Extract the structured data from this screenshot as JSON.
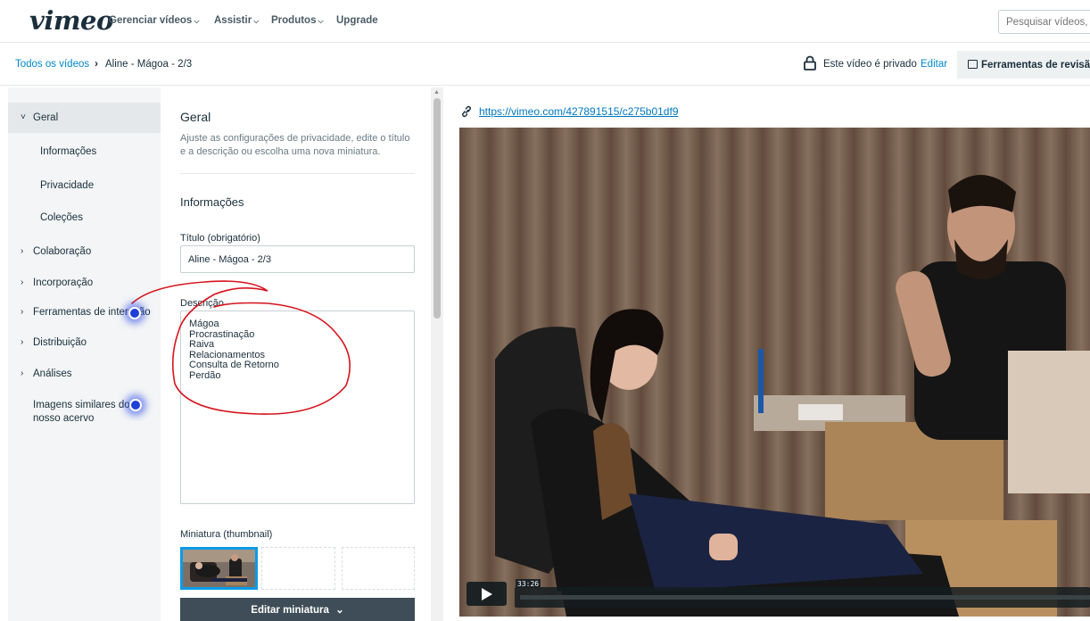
{
  "nav": {
    "logo": "vimeo",
    "items": [
      {
        "label": "Gerenciar vídeos",
        "has_menu": true
      },
      {
        "label": "Assistir",
        "has_menu": true
      },
      {
        "label": "Produtos",
        "has_menu": true
      },
      {
        "label": "Upgrade",
        "has_menu": false
      }
    ],
    "search_placeholder": "Pesquisar vídeos,"
  },
  "breadcrumb": {
    "root": "Todos os vídeos",
    "separator": "›",
    "current": "Aline - Mágoa - 2/3"
  },
  "privacy": {
    "icon": "lock-icon",
    "text": "Este vídeo é privado",
    "edit": "Editar"
  },
  "review_tools": {
    "icon": "review-icon",
    "label": "Ferramentas de revisã"
  },
  "sidebar": {
    "items": [
      {
        "label": "Geral",
        "caret": "˅",
        "active": true
      },
      {
        "label": "Informações",
        "sub": true
      },
      {
        "label": "Privacidade",
        "sub": true
      },
      {
        "label": "Coleções",
        "sub": true
      },
      {
        "label": "Colaboração",
        "caret": "›"
      },
      {
        "label": "Incorporação",
        "caret": "›"
      },
      {
        "label": "Ferramentas de interação",
        "caret": "›"
      },
      {
        "label": "Distribuição",
        "caret": "›"
      },
      {
        "label": "Análises",
        "caret": "›"
      },
      {
        "label": "Imagens similares do",
        "label2": "nosso acervo"
      }
    ]
  },
  "panel": {
    "title": "Geral",
    "description": "Ajuste as configurações de privacidade, edite o título e a descrição ou escolha uma nova miniatura.",
    "section": "Informações",
    "title_label": "Título (obrigatório)",
    "title_value": "Aline - Mágoa - 2/3",
    "desc_label": "Descrição",
    "desc_value": "Mágoa\nProcrastinação\nRaiva\nRelacionamentos\nConsulta de Retorno\nPerdão",
    "thumb_label": "Miniatura (thumbnail)",
    "edit_thumb": "Editar miniatura",
    "edit_thumb_chevron": "⌄"
  },
  "video": {
    "link_icon": "link-icon",
    "url": "https://vimeo.com/427891515/c275b01df9",
    "time": "33:26",
    "progress": 0.0
  },
  "colors": {
    "link": "#0088cc",
    "sidebar_bg": "#f3f5f6",
    "button_dark": "#3e4d57",
    "thumb_selected": "#0a9be6",
    "annotation": "#d6141e",
    "cursor_dot": "#1f3fd9"
  }
}
